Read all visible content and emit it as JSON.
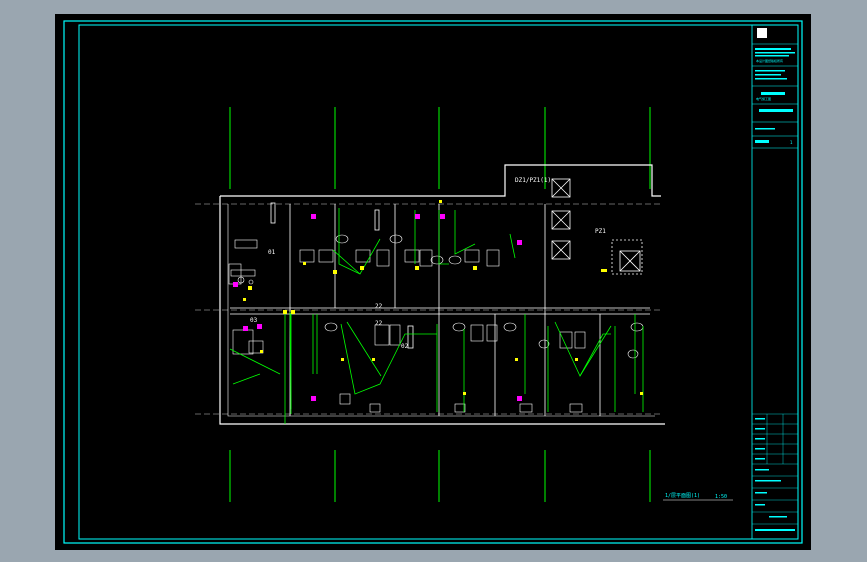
{
  "labels": {
    "room_a": "01",
    "room_b": "02",
    "room_c": "03",
    "top_note": "DZ1/PZ1(1)",
    "dim_top": "22",
    "dim_mid": "22",
    "elev_note": "PZ1",
    "plan_title": "1/层平面图(1)",
    "plan_scale": "1:50"
  },
  "title_block": {
    "company": "本设计图纸版权所有",
    "project": "电气施工图",
    "sheet_no": "1"
  },
  "colors": {
    "background": "#000000",
    "border": "#00ffff",
    "walls": "#ffffff",
    "conduit": "#00ff00",
    "fixtures": "#ffff00",
    "outlets": "#ff00ff"
  }
}
